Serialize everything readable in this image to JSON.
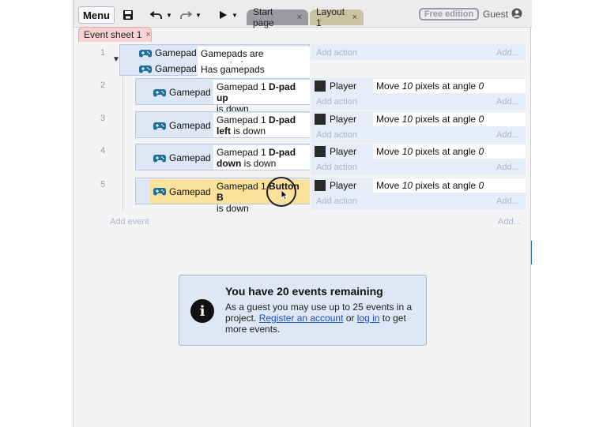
{
  "toolbar": {
    "menu_label": "Menu",
    "tabs": [
      {
        "label": "Start page",
        "close": "×"
      },
      {
        "label": "Layout 1",
        "close": "×"
      }
    ],
    "edition_badge": "Free edition",
    "user_label": "Guest"
  },
  "sheet_tab": {
    "label": "Event sheet 1",
    "close": "×"
  },
  "events": [
    {
      "number": "1",
      "conditions": [
        {
          "object": "Gamepad",
          "text": "Gamepads are supported"
        },
        {
          "object": "Gamepad",
          "text": "Has gamepads"
        }
      ],
      "add_action": "Add action",
      "add_right": "Add..."
    },
    {
      "number": "2",
      "condition": {
        "object": "Gamepad",
        "pre": "Gamepad 1 ",
        "bold": "D-pad up",
        "post": "is down"
      },
      "action": {
        "object": "Player",
        "pre": "Move ",
        "val": "10",
        "mid": " pixels at angle ",
        "angle": "0"
      },
      "add_action": "Add action",
      "add_right": "Add..."
    },
    {
      "number": "3",
      "condition": {
        "object": "Gamepad",
        "pre": "Gamepad 1 ",
        "bold1": "D-pad",
        "bold2": "left",
        "post": " is down"
      },
      "action": {
        "object": "Player",
        "pre": "Move ",
        "val": "10",
        "mid": " pixels at angle ",
        "angle": "0"
      },
      "add_action": "Add action",
      "add_right": "Add..."
    },
    {
      "number": "4",
      "condition": {
        "object": "Gamepad",
        "pre": "Gamepad 1 ",
        "bold1": "D-pad",
        "bold2": "down",
        "post": " is down"
      },
      "action": {
        "object": "Player",
        "pre": "Move ",
        "val": "10",
        "mid": " pixels at angle ",
        "angle": "0"
      },
      "add_action": "Add action",
      "add_right": "Add..."
    },
    {
      "number": "5",
      "condition": {
        "object": "Gamepad",
        "pre": "Gamepad 1 ",
        "bold": "Button B",
        "post": "is down"
      },
      "action": {
        "object": "Player",
        "pre": "Move ",
        "val": "10",
        "mid": " pixels at angle ",
        "angle": "0"
      },
      "add_action": "Add action",
      "add_right": "Add..."
    }
  ],
  "add_event": "Add event",
  "add_event_right": "Add...",
  "info": {
    "title": "You have 20 events remaining",
    "line1": "As a guest you may use up to 25 events in a project. ",
    "link1": "Register an account",
    "mid": " or ",
    "link2": "log in",
    "line2": " to get more events."
  },
  "colors": {
    "condition_bg": "#dde7f5",
    "highlight": "#fbe29a",
    "sheet_tab": "#f7d3d3",
    "link": "#1a4fc4"
  }
}
